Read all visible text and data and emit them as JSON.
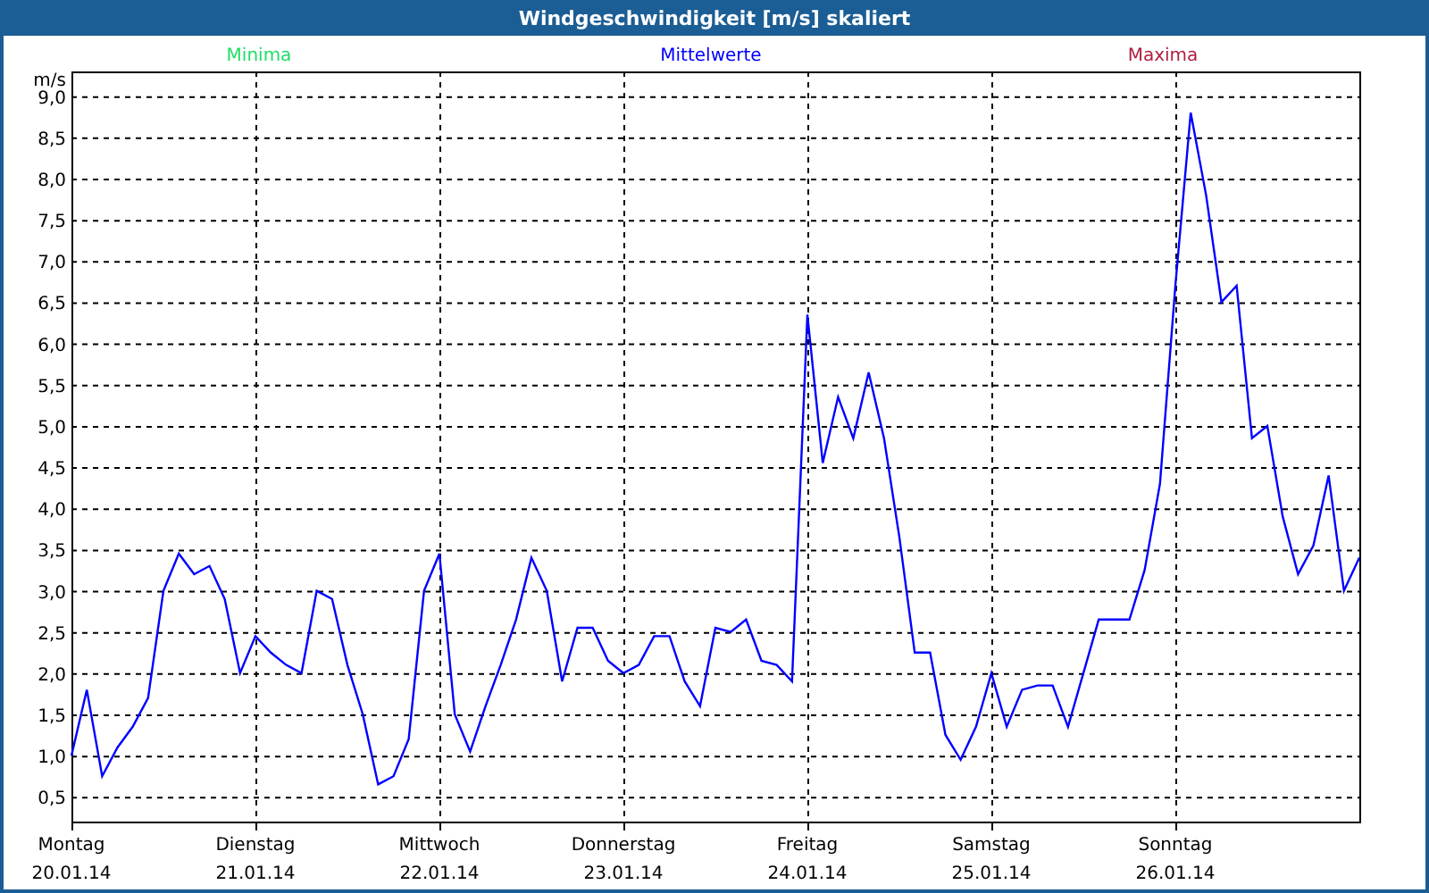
{
  "window": {
    "title": "Windgeschwindigkeit [m/s] skaliert"
  },
  "legend": [
    {
      "label": "Minima",
      "color": "#22dd66"
    },
    {
      "label": "Maxima",
      "color": "#b02040"
    }
  ],
  "date_labels": [
    "20.01.14",
    "21.01.14",
    "22.01.14",
    "23.01.14",
    "24.01.14",
    "25.01.14",
    "26.01.14"
  ],
  "chart_data": {
    "type": "line",
    "grid": true,
    "ylabel": "m/s",
    "ylim": [
      0.2,
      9.3
    ],
    "categories": [
      "Montag",
      null,
      null,
      null,
      null,
      null,
      null,
      null,
      null,
      null,
      null,
      null,
      "Dienstag",
      null,
      null,
      null,
      null,
      null,
      null,
      null,
      null,
      null,
      null,
      null,
      "Mittwoch",
      null,
      null,
      null,
      null,
      null,
      null,
      null,
      null,
      null,
      null,
      null,
      "Donnerstag",
      null,
      null,
      null,
      null,
      null,
      null,
      null,
      null,
      null,
      null,
      null,
      "Freitag",
      null,
      null,
      null,
      null,
      null,
      null,
      null,
      null,
      null,
      null,
      null,
      "Samstag",
      null,
      null,
      null,
      null,
      null,
      null,
      null,
      null,
      null,
      null,
      null,
      "Sonntag",
      null,
      null,
      null,
      null,
      null,
      null,
      null,
      null,
      null,
      null,
      null,
      null
    ],
    "yticks": [
      {
        "value": 0.5,
        "label": "0,5"
      },
      {
        "value": 1,
        "label": "1,0"
      },
      {
        "value": 1.5,
        "label": "1,5"
      },
      {
        "value": 2,
        "label": "2,0"
      },
      {
        "value": 2.5,
        "label": "2,5"
      },
      {
        "value": 3,
        "label": "3,0"
      },
      {
        "value": 3.5,
        "label": "3,5"
      },
      {
        "value": 4,
        "label": "4,0"
      },
      {
        "value": 4.5,
        "label": "4,5"
      },
      {
        "value": 5,
        "label": "5,0"
      },
      {
        "value": 5.5,
        "label": "5,5"
      },
      {
        "value": 6,
        "label": "6,0"
      },
      {
        "value": 6.5,
        "label": "6,5"
      },
      {
        "value": 7,
        "label": "7,0"
      },
      {
        "value": 7.5,
        "label": "7,5"
      },
      {
        "value": 8,
        "label": "8,0"
      },
      {
        "value": 8.5,
        "label": "8,5"
      },
      {
        "value": 9,
        "label": "9,0"
      }
    ],
    "series": [
      {
        "name": "Mittelwerte",
        "color": "#0000ff",
        "values": [
          1.0,
          1.8,
          0.75,
          1.1,
          1.35,
          1.7,
          3.0,
          3.45,
          3.2,
          3.3,
          2.9,
          2.0,
          2.45,
          2.25,
          2.1,
          2.0,
          3.0,
          2.9,
          2.1,
          1.5,
          0.65,
          0.75,
          1.2,
          3.0,
          3.45,
          1.5,
          1.05,
          1.6,
          2.1,
          2.65,
          3.4,
          3.0,
          1.9,
          2.55,
          2.55,
          2.15,
          2.0,
          2.1,
          2.45,
          2.45,
          1.9,
          1.6,
          2.55,
          2.5,
          2.65,
          2.15,
          2.1,
          1.9,
          6.35,
          4.55,
          5.35,
          4.85,
          5.65,
          4.85,
          3.65,
          2.25,
          2.25,
          1.25,
          0.95,
          1.35,
          2.0,
          1.35,
          1.8,
          1.85,
          1.85,
          1.35,
          2.0,
          2.65,
          2.65,
          2.65,
          3.25,
          4.3,
          6.7,
          8.8,
          7.8,
          6.5,
          6.7,
          4.85,
          5.0,
          3.9,
          3.2,
          3.55,
          4.4,
          3.0,
          3.4
        ]
      }
    ]
  }
}
